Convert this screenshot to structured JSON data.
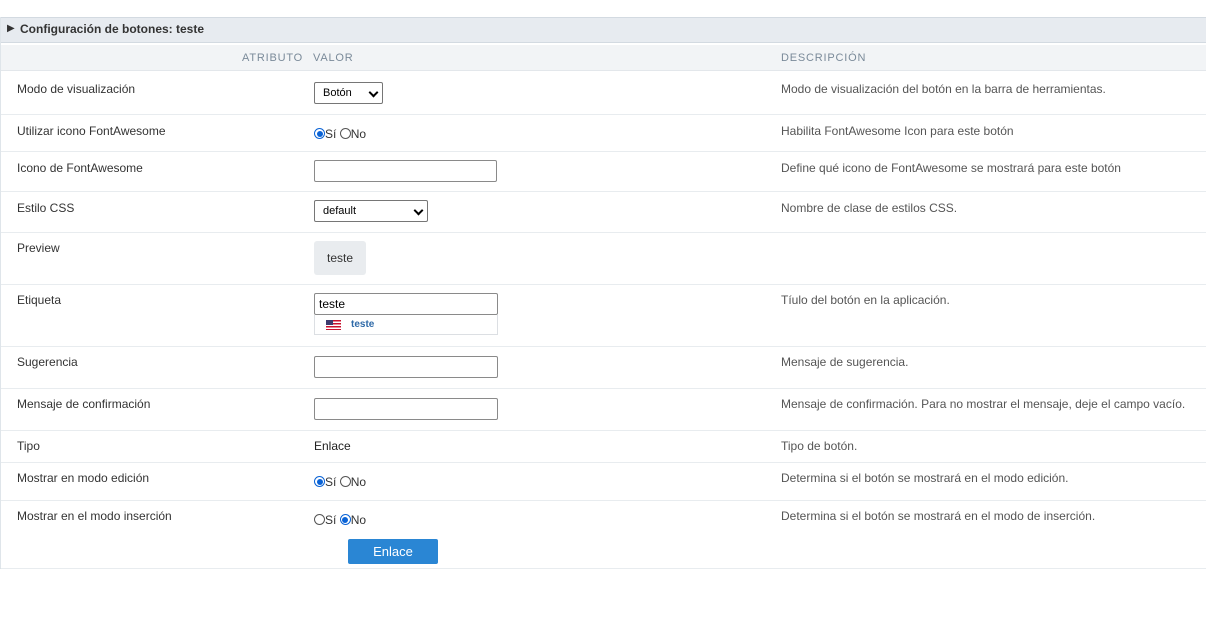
{
  "header": {
    "title": "Configuración de botones: teste"
  },
  "columns": {
    "attribute": "ATRIBUTO",
    "value": "VALOR",
    "description": "DESCRIPCIÓN"
  },
  "rows": {
    "display_mode": {
      "label": "Modo de visualización",
      "value": "Botón",
      "description": "Modo de visualización del botón en la barra de herramientas."
    },
    "use_icon": {
      "label": "Utilizar icono FontAwesome",
      "yes": "Sí",
      "no": "No",
      "selected": "Sí",
      "description": "Habilita FontAwesome Icon para este botón"
    },
    "fa_icon": {
      "label": "Icono de FontAwesome",
      "value": "",
      "description": "Define qué icono de FontAwesome se mostrará para este botón"
    },
    "css_style": {
      "label": "Estilo CSS",
      "value": "default",
      "description": "Nombre de clase de estilos CSS."
    },
    "preview": {
      "label": "Preview",
      "button_text": "teste"
    },
    "label_field": {
      "label": "Etiqueta",
      "value": "teste",
      "lang_value": "teste",
      "description": "Tíulo del botón en la aplicación."
    },
    "hint": {
      "label": "Sugerencia",
      "value": "",
      "description": "Mensaje de sugerencia."
    },
    "confirm": {
      "label": "Mensaje de confirmación",
      "value": "",
      "description": "Mensaje de confirmación. Para no mostrar el mensaje, deje el campo vacío."
    },
    "type": {
      "label": "Tipo",
      "value": "Enlace",
      "description": "Tipo de botón."
    },
    "show_edit": {
      "label": "Mostrar en modo edición",
      "yes": "Sí",
      "no": "No",
      "selected": "Sí",
      "description": "Determina si el botón se mostrará en el modo edición."
    },
    "show_insert": {
      "label": "Mostrar en el modo inserción",
      "yes": "Sí",
      "no": "No",
      "selected": "No",
      "description": "Determina si el botón se mostrará en el modo de inserción."
    }
  },
  "submit": {
    "label": "Enlace"
  },
  "colors": {
    "accent": "#2a86d4",
    "header_bg": "#e7ebf0",
    "radio_checked": "#0a63d6"
  }
}
